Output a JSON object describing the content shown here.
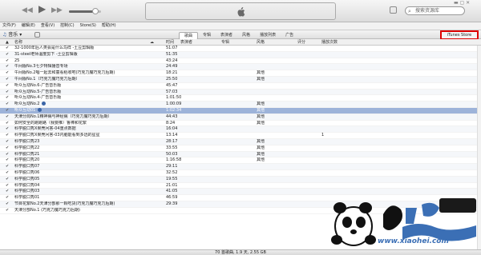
{
  "search": {
    "placeholder": "搜索资源库"
  },
  "playback": {
    "prev": "◀◀",
    "play": "▶",
    "next": "▶▶",
    "volume_level": 0.82
  },
  "menu": [
    "文件(F)",
    "编辑(E)",
    "查看(V)",
    "控制(C)",
    "Store(S)",
    "帮助(H)"
  ],
  "nav": {
    "library_label": "音乐",
    "tabs": [
      "歌曲",
      "专辑",
      "表演者",
      "风格",
      "播放列表",
      "广告"
    ],
    "store_button": "iTunes Store"
  },
  "columns": {
    "name": "名称",
    "time": "时间",
    "artist": "表演者",
    "album": "专辑",
    "genre": "风格",
    "rating": "评分",
    "plays": "播放次数"
  },
  "tracks": [
    {
      "name": "32-1000年后人类会是什么鸟样 -土豆剪辑版",
      "time": "51:07",
      "genre": "",
      "plays": ""
    },
    {
      "name": "31-steel老师温度剪下 -土豆剪辑版",
      "time": "51:35",
      "genre": "",
      "plays": ""
    },
    {
      "name": "25",
      "time": "43:24",
      "genre": "",
      "plays": ""
    },
    {
      "name": "午间版No.3七夕特辑播音专场",
      "time": "24:49",
      "genre": "",
      "plays": ""
    },
    {
      "name": "午间版No.2唱一起去和童看稻收吧(巧克力魔巧克力后期)",
      "time": "18:21",
      "genre": "其他",
      "plays": ""
    },
    {
      "name": "午间版No.1（巧克力魔巧克力后期）",
      "time": "25:50",
      "genre": "其他",
      "plays": ""
    },
    {
      "name": "听众互动No.6-广告音乐版",
      "time": "45:47",
      "genre": "",
      "plays": ""
    },
    {
      "name": "听众互动No.5-广告音乐版",
      "time": "57:03",
      "genre": "",
      "plays": ""
    },
    {
      "name": "听众互动No.4-广告音乐版",
      "time": "1:01:50",
      "genre": "",
      "plays": ""
    },
    {
      "name": "听众互动No.2",
      "time": "1:00:09",
      "genre": "其他",
      "plays": ""
    },
    {
      "name": "听众互动01",
      "time": "1:02:34",
      "genre": "其他",
      "plays": ""
    },
    {
      "name": "天津分局No.1精神病与神经病（巧克力魔巧克力后期）",
      "time": "44:43",
      "genre": "其他",
      "plays": ""
    },
    {
      "name": "如何安全的跑跑路（我要推）鲁棒和花絮",
      "time": "8:24",
      "genre": "其他",
      "plays": ""
    },
    {
      "name": "科学脱口秀X果壳问答-04重点数据",
      "time": "16:04",
      "genre": "",
      "plays": ""
    },
    {
      "name": "科学脱口秀X果壳问答-03内脑能看到多远的星星",
      "time": "13:14",
      "genre": "",
      "plays": "1"
    },
    {
      "name": "科学脱口秀23",
      "time": "28:17",
      "genre": "其他",
      "plays": ""
    },
    {
      "name": "科学脱口秀22",
      "time": "33:55",
      "genre": "其他",
      "plays": ""
    },
    {
      "name": "科学脱口秀21",
      "time": "50:03",
      "genre": "其他",
      "plays": ""
    },
    {
      "name": "科学脱口秀20",
      "time": "1:16:58",
      "genre": "其他",
      "plays": ""
    },
    {
      "name": "科学脱口秀07",
      "time": "29:11",
      "genre": "",
      "plays": ""
    },
    {
      "name": "科学脱口秀06",
      "time": "32:52",
      "genre": "",
      "plays": ""
    },
    {
      "name": "科学脱口秀05",
      "time": "19:55",
      "genre": "",
      "plays": ""
    },
    {
      "name": "科学脱口秀04",
      "time": "21:01",
      "genre": "",
      "plays": ""
    },
    {
      "name": "科学脱口秀03",
      "time": "41:05",
      "genre": "",
      "plays": ""
    },
    {
      "name": "科学脱口秀01",
      "time": "46:59",
      "genre": "",
      "plays": ""
    },
    {
      "name": "节目花絮No.2天津分部那一颗吃货(巧克力魔巧克力后期)",
      "time": "29:39",
      "genre": "",
      "plays": ""
    },
    {
      "name": "天津分部No.1 (巧克力魔巧克力后期)",
      "time": "",
      "genre": "",
      "plays": ""
    }
  ],
  "selected_row": 10,
  "status_text": "70 首歌曲, 1.9 天, 2.55 GB",
  "watermark": {
    "url": "www.xiaohei.com",
    "logo_text": "小黑下载站 游戏"
  },
  "colors": {
    "selection": "#9db3d9",
    "store_highlight": "#d00000",
    "watermark_blue": "#3b6fb5"
  }
}
